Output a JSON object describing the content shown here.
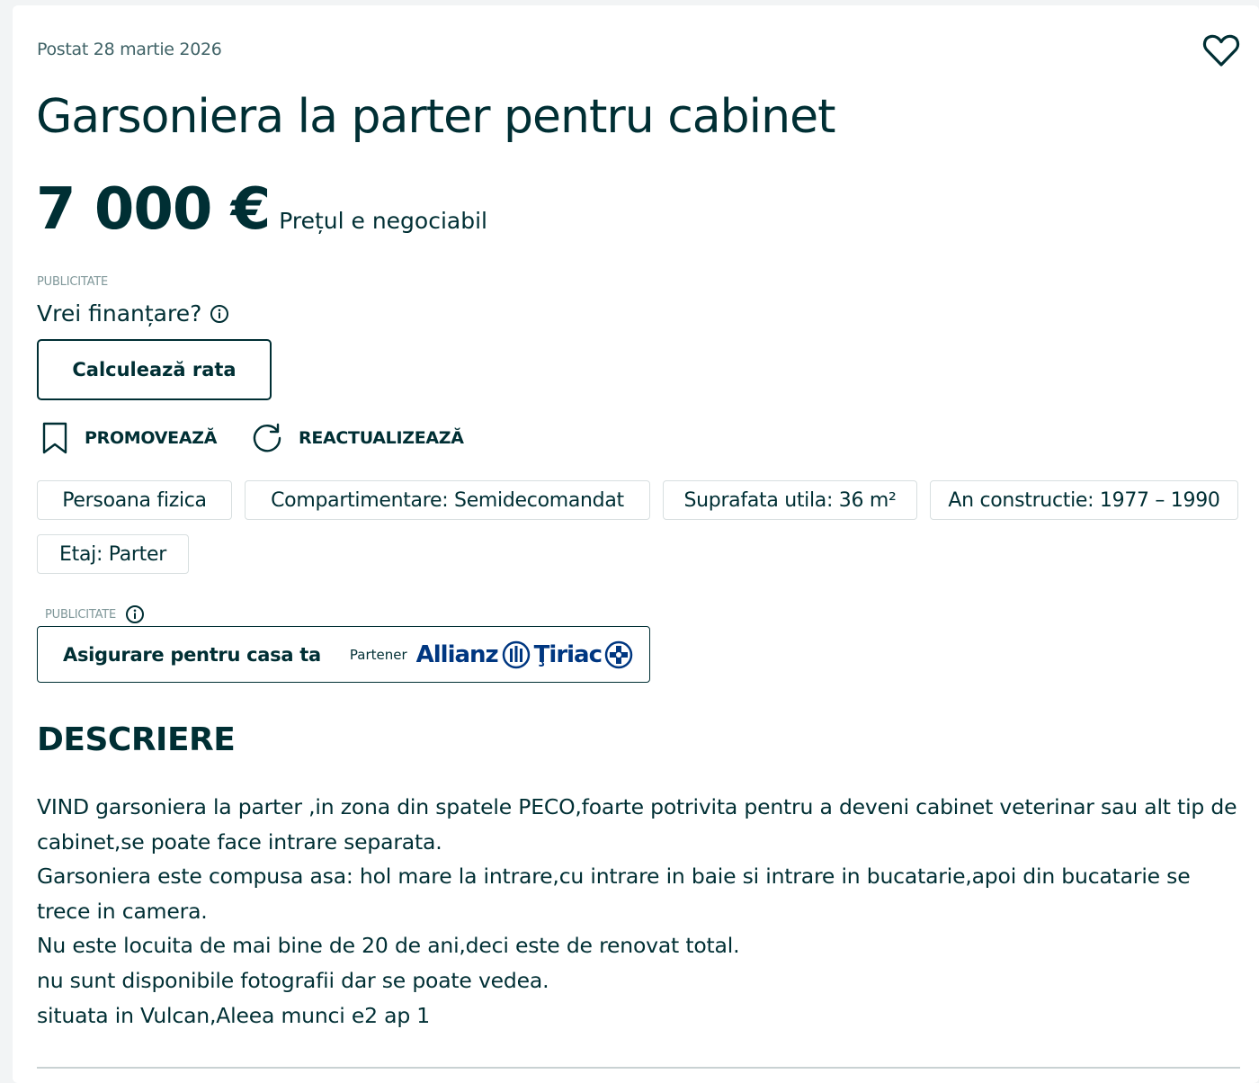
{
  "listing": {
    "posted": "Postat 28 martie 2026",
    "title": "Garsoniera la parter pentru cabinet",
    "price": "7 000 €",
    "negotiable": "Prețul e negociabil",
    "favorite_icon": "heart-outline-icon"
  },
  "financing": {
    "ad_label": "PUBLICITATE",
    "question": "Vrei finanțare?",
    "info_icon": "info-icon",
    "button_label": "Calculează rata"
  },
  "actions": {
    "promote_label": "PROMOVEAZĂ",
    "promote_icon": "bookmark-icon",
    "refresh_label": "REACTUALIZEAZĂ",
    "refresh_icon": "refresh-icon"
  },
  "tags": [
    "Persoana fizica",
    "Compartimentare: Semidecomandat",
    "Suprafata utila: 36 m²",
    "An constructie: 1977 – 1990",
    "Etaj: Parter"
  ],
  "insurance": {
    "ad_label": "PUBLICITATE",
    "title": "Asigurare pentru casa ta",
    "partner_label": "Partener",
    "brand_part1": "Allianz",
    "brand_part2": "Ţiriac"
  },
  "description": {
    "heading": "DESCRIERE",
    "lines": [
      "VIND garsoniera la parter ,in zona din spatele PECO,foarte potrivita pentru a deveni cabinet veterinar sau alt tip de cabinet,se poate face intrare separata.",
      "Garsoniera este compusa asa: hol mare la intrare,cu intrare in baie si intrare in bucatarie,apoi din bucatarie se trece in camera.",
      "Nu este locuita de mai bine de 20 de ani,deci este de renovat total.",
      "nu sunt disponibile fotografii dar se poate vedea.",
      "situata in Vulcan,Aleea munci e2 ap 1"
    ]
  },
  "colors": {
    "text_primary": "#002f34",
    "text_muted": "#406367",
    "tag_border": "#d8dfe0",
    "brand_allianz": "#003781"
  }
}
